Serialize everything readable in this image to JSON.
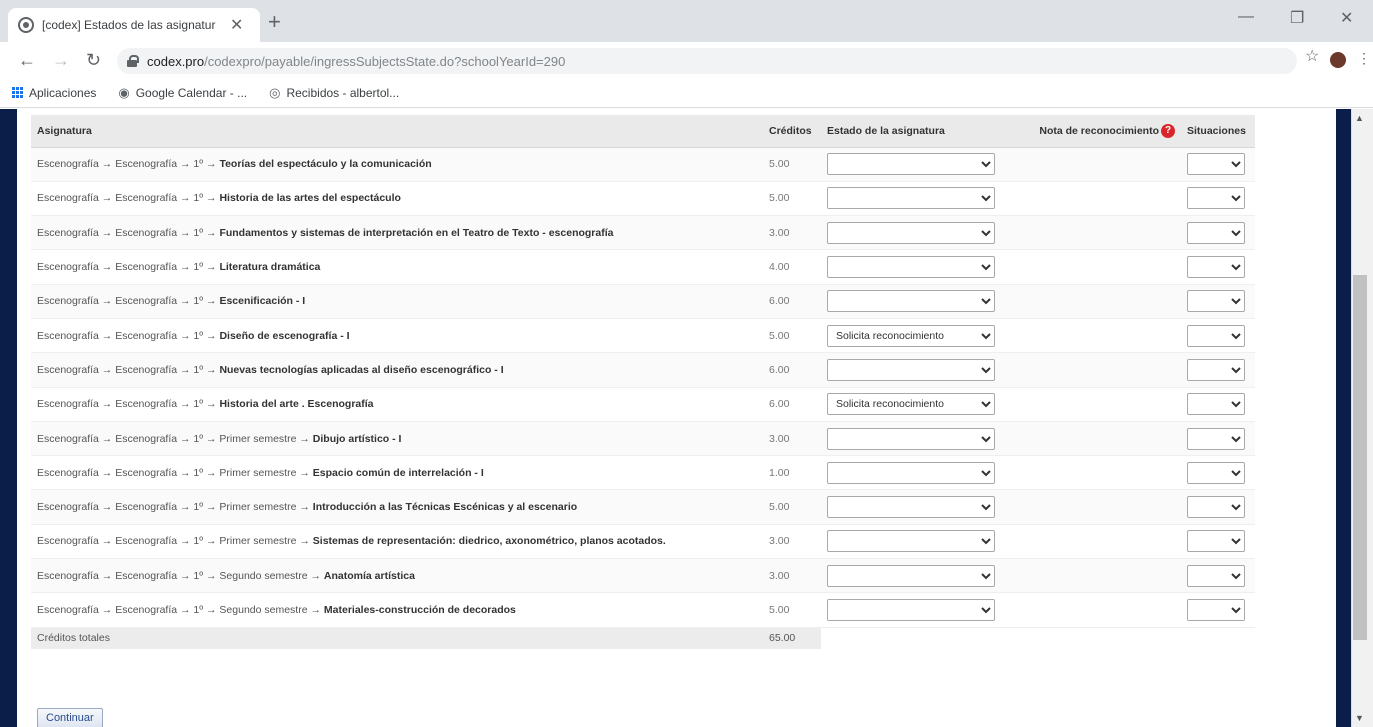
{
  "browser": {
    "tab_title": "[codex] Estados de las asignatur",
    "url_host": "codex.pro",
    "url_path": "/codexpro/payable/ingressSubjectsState.do?schoolYearId=290",
    "bookmarks": [
      {
        "label": "Aplicaciones",
        "icon": "apps-icon"
      },
      {
        "label": "Google Calendar - ...",
        "icon": "google-icon"
      },
      {
        "label": "Recibidos - albertol...",
        "icon": "globe-icon"
      }
    ]
  },
  "table": {
    "headers": {
      "subject": "Asignatura",
      "credits": "Créditos",
      "state": "Estado de la asignatura",
      "note": "Nota de reconocimiento",
      "situations": "Situaciones"
    },
    "rows": [
      {
        "path": "Escenografía → Escenografía → 1º →",
        "name": "Teorías del espectáculo y la comunicación",
        "credits": "5.00",
        "state": ""
      },
      {
        "path": "Escenografía → Escenografía → 1º →",
        "name": "Historia de las artes del espectáculo",
        "credits": "5.00",
        "state": ""
      },
      {
        "path": "Escenografía → Escenografía → 1º →",
        "name": "Fundamentos y sistemas de interpretación en el Teatro de Texto - escenografía",
        "credits": "3.00",
        "state": ""
      },
      {
        "path": "Escenografía → Escenografía → 1º →",
        "name": "Literatura dramática",
        "credits": "4.00",
        "state": ""
      },
      {
        "path": "Escenografía → Escenografía → 1º →",
        "name": "Escenificación - I",
        "credits": "6.00",
        "state": ""
      },
      {
        "path": "Escenografía → Escenografía → 1º →",
        "name": "Diseño de escenografía - I",
        "credits": "5.00",
        "state": "Solicita reconocimiento"
      },
      {
        "path": "Escenografía → Escenografía → 1º →",
        "name": "Nuevas tecnologías aplicadas al diseño escenográfico - I",
        "credits": "6.00",
        "state": ""
      },
      {
        "path": "Escenografía → Escenografía → 1º →",
        "name": "Historia del arte . Escenografía",
        "credits": "6.00",
        "state": "Solicita reconocimiento"
      },
      {
        "path": "Escenografía → Escenografía → 1º → Primer semestre →",
        "name": "Dibujo artístico - I",
        "credits": "3.00",
        "state": ""
      },
      {
        "path": "Escenografía → Escenografía → 1º → Primer semestre →",
        "name": "Espacio común de interrelación - I",
        "credits": "1.00",
        "state": ""
      },
      {
        "path": "Escenografía → Escenografía → 1º → Primer semestre →",
        "name": "Introducción a las Técnicas Escénicas y al escenario",
        "credits": "5.00",
        "state": ""
      },
      {
        "path": "Escenografía → Escenografía → 1º → Primer semestre →",
        "name": "Sistemas de representación: diedrico, axonométrico, planos acotados.",
        "credits": "3.00",
        "state": ""
      },
      {
        "path": "Escenografía → Escenografía → 1º → Segundo semestre →",
        "name": "Anatomía artística",
        "credits": "3.00",
        "state": ""
      },
      {
        "path": "Escenografía → Escenografía → 1º → Segundo semestre →",
        "name": "Materiales-construcción de decorados",
        "credits": "5.00",
        "state": ""
      }
    ],
    "total_label": "Créditos totales",
    "total_value": "65.00"
  },
  "continue_label": "Continuar",
  "colors": {
    "sidebar": "#0a1e49",
    "header_bg": "#eaeaea",
    "help_icon": "#d9262c"
  }
}
